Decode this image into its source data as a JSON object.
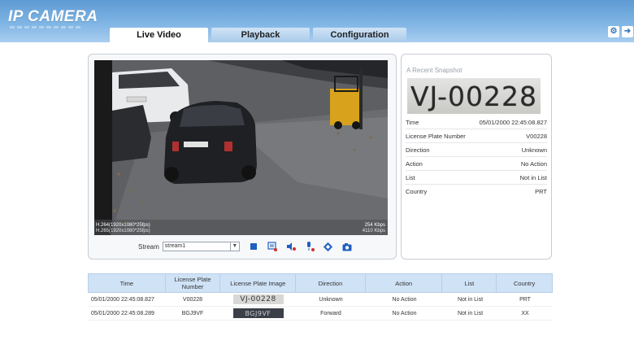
{
  "header": {
    "logo": "IP CAMERA",
    "tabs": [
      {
        "label": "Live Video",
        "active": true
      },
      {
        "label": "Playback",
        "active": false
      },
      {
        "label": "Configuration",
        "active": false
      }
    ],
    "icons": [
      "settings-icon",
      "logout-icon"
    ]
  },
  "video": {
    "osd_left_1": "H.264(1920x1080*25fps)",
    "osd_left_2": "H.265(1920x1080*25fps)",
    "osd_right_1": "254 Kbps",
    "osd_right_2": "4110 Kbps"
  },
  "controls": {
    "stream_label": "Stream",
    "stream_value": "stream1",
    "buttons": [
      "stop-icon",
      "record-icon",
      "audio-icon",
      "talk-icon",
      "settings-icon",
      "snapshot-icon"
    ]
  },
  "snapshot": {
    "title": "A Recent Snapshot",
    "plate_text": "VJ-00228",
    "fields": [
      {
        "label": "Time",
        "value": "05/01/2000 22:45:08.827"
      },
      {
        "label": "License Plate Number",
        "value": "V00228"
      },
      {
        "label": "Direction",
        "value": "Unknown"
      },
      {
        "label": "Action",
        "value": "No Action"
      },
      {
        "label": "List",
        "value": "Not in List"
      },
      {
        "label": "Country",
        "value": "PRT"
      }
    ]
  },
  "table": {
    "columns": [
      "Time",
      "License Plate Number",
      "License Plate Image",
      "Direction",
      "Action",
      "List",
      "Country"
    ],
    "rows": [
      {
        "time": "05/01/2000 22:45:08.827",
        "plate": "V00228",
        "image_text": "VJ-00228",
        "direction": "Unknown",
        "action": "No Action",
        "list": "Not in List",
        "country": "PRT"
      },
      {
        "time": "05/01/2000 22:45:08.289",
        "plate": "BGJ9VF",
        "image_text": "BGJ9VF",
        "direction": "Forward",
        "action": "No Action",
        "list": "Not in List",
        "country": "XX"
      }
    ]
  },
  "colors": {
    "header_top": "#5e9ad3",
    "header_bottom": "#a9cdef",
    "table_header": "#cfe2f6",
    "control_icon": "#1f5fbf"
  }
}
